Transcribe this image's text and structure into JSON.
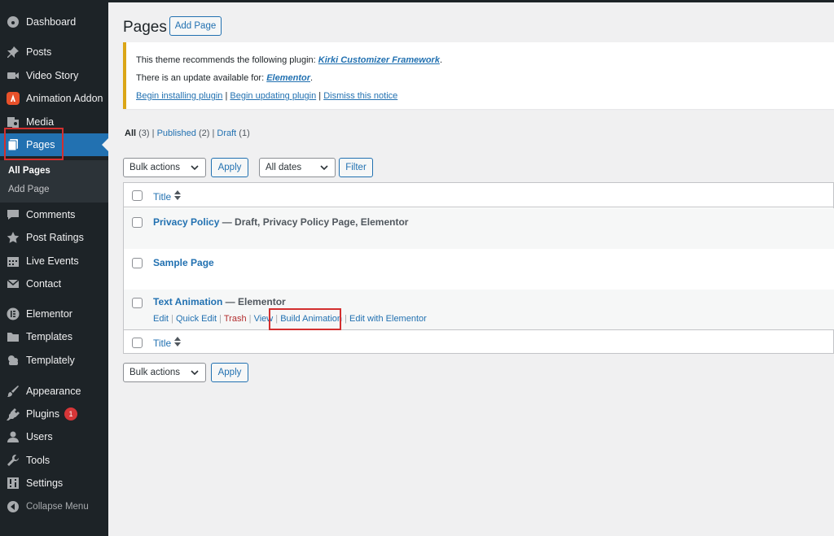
{
  "sidebar": {
    "items": [
      {
        "label": "Dashboard",
        "icon": "dashboard-icon"
      },
      {
        "label": "Posts",
        "icon": "pin-icon"
      },
      {
        "label": "Video Story",
        "icon": "video-icon"
      },
      {
        "label": "Animation Addon",
        "icon": "animation-addon-icon"
      },
      {
        "label": "Media",
        "icon": "media-icon"
      },
      {
        "label": "Pages",
        "icon": "pages-icon"
      },
      {
        "label": "Comments",
        "icon": "comments-icon"
      },
      {
        "label": "Post Ratings",
        "icon": "star-icon"
      },
      {
        "label": "Live Events",
        "icon": "calendar-icon"
      },
      {
        "label": "Contact",
        "icon": "mail-icon"
      },
      {
        "label": "Elementor",
        "icon": "elementor-icon"
      },
      {
        "label": "Templates",
        "icon": "folder-icon"
      },
      {
        "label": "Templately",
        "icon": "templately-icon"
      },
      {
        "label": "Appearance",
        "icon": "brush-icon"
      },
      {
        "label": "Plugins",
        "icon": "plugin-icon",
        "badge": "1"
      },
      {
        "label": "Users",
        "icon": "user-icon"
      },
      {
        "label": "Tools",
        "icon": "wrench-icon"
      },
      {
        "label": "Settings",
        "icon": "settings-icon"
      }
    ],
    "submenu": [
      "All Pages",
      "Add Page"
    ],
    "collapse_label": "Collapse Menu"
  },
  "header": {
    "title": "Pages",
    "add_button": "Add Page"
  },
  "notice": {
    "line1_prefix": "This theme recommends the following plugin: ",
    "line1_link": "Kirki Customizer Framework",
    "line1_suffix": ".",
    "line2_prefix": "There is an update available for: ",
    "line2_link": "Elementor",
    "line2_suffix": ".",
    "link_install": "Begin installing plugin",
    "link_update": "Begin updating plugin",
    "link_dismiss": "Dismiss this notice",
    "sep": "|"
  },
  "filters": {
    "all": "All",
    "all_count": "(3)",
    "published": "Published",
    "published_count": "(2)",
    "draft": "Draft",
    "draft_count": "(1)",
    "sep": "|"
  },
  "toolbar": {
    "bulk_actions": "Bulk actions",
    "apply": "Apply",
    "dates": "All dates",
    "filter": "Filter"
  },
  "table": {
    "header_title": "Title",
    "footer_title": "Title",
    "rows": [
      {
        "title": "Privacy Policy",
        "state": " — Draft, Privacy Policy Page, Elementor"
      },
      {
        "title": "Sample Page",
        "state": ""
      },
      {
        "title": "Text Animation",
        "state": " — Elementor"
      }
    ],
    "row_actions": {
      "edit": "Edit",
      "quick_edit": "Quick Edit",
      "trash": "Trash",
      "view": "View",
      "build_animation": "Build Animation",
      "edit_elementor": "Edit with Elementor",
      "sep": "|"
    }
  },
  "bottom": {
    "bulk_actions": "Bulk actions",
    "apply": "Apply"
  },
  "colors": {
    "accent": "#2271b1",
    "sidebar": "#1d2327",
    "highlight_box": "#d32f2f",
    "notice_border": "#dba617"
  }
}
